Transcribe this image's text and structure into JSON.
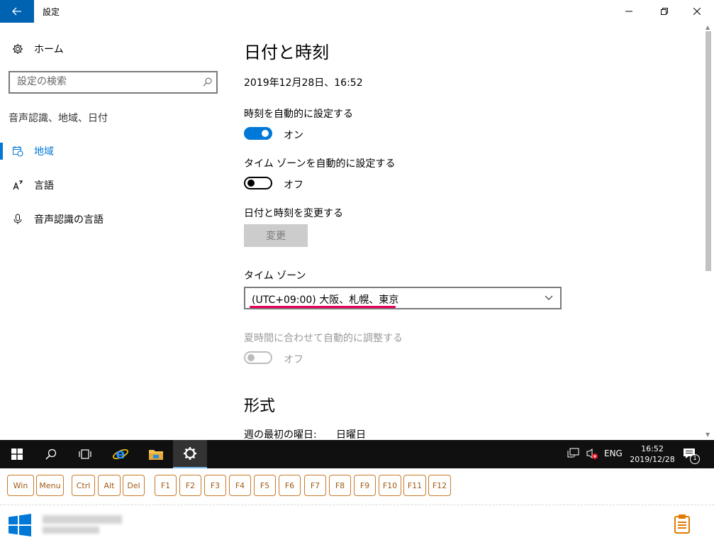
{
  "window": {
    "title": "設定"
  },
  "nav": {
    "home_label": "ホーム",
    "search_placeholder": "設定の検索",
    "section_label": "音声認識、地域、日付",
    "items": [
      {
        "label": "地域",
        "active": true
      },
      {
        "label": "言語",
        "active": false
      },
      {
        "label": "音声認識の言語",
        "active": false
      }
    ]
  },
  "main": {
    "title": "日付と時刻",
    "current_datetime": "2019年12月28日、16:52",
    "auto_time": {
      "label": "時刻を自動的に設定する",
      "state": "オン"
    },
    "auto_timezone": {
      "label": "タイム ゾーンを自動的に設定する",
      "state": "オフ"
    },
    "change": {
      "label": "日付と時刻を変更する",
      "button": "変更"
    },
    "timezone": {
      "label": "タイム ゾーン",
      "value": "(UTC+09:00) 大阪、札幌、東京"
    },
    "dst": {
      "label": "夏時間に合わせて自動的に調整する",
      "state": "オフ"
    },
    "format": {
      "title": "形式",
      "first_day_label": "週の最初の曜日:",
      "first_day_value": "日曜日"
    }
  },
  "taskbar": {
    "ime": "ENG",
    "time": "16:52",
    "date": "2019/12/28",
    "notifications": "1"
  },
  "keys": [
    "Win",
    "Menu",
    "Ctrl",
    "Alt",
    "Del",
    "F1",
    "F2",
    "F3",
    "F4",
    "F5",
    "F6",
    "F7",
    "F8",
    "F9",
    "F10",
    "F11",
    "F12"
  ],
  "colors": {
    "accent": "#0078d7",
    "title_accent": "#0063b1",
    "underline": "#e8005a",
    "key_border": "#c97a2a"
  }
}
